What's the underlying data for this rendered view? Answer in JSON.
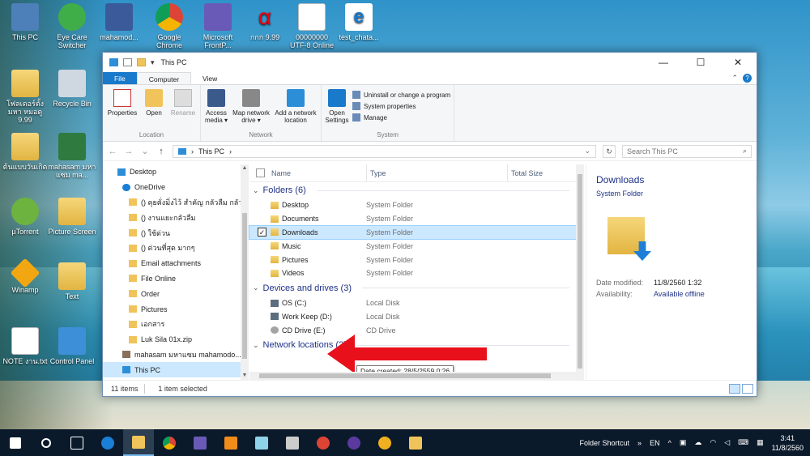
{
  "desktop": {
    "icons": [
      {
        "label": "This PC"
      },
      {
        "label": "Eye Care Switcher"
      },
      {
        "label": "mahamod..."
      },
      {
        "label": "Google Chrome"
      },
      {
        "label": "Microsoft FrontP..."
      },
      {
        "label": "กกก 9.99"
      },
      {
        "label": "00000000 UTF-8 Online"
      },
      {
        "label": "test_chata..."
      },
      {
        "label": "โฟลเดอร์ตั้ง มหา หมอดู 9.99"
      },
      {
        "label": "Recycle Bin"
      },
      {
        "label": "ต้นแบบวันเกิด"
      },
      {
        "label": "mahasam มหาแซม ma..."
      },
      {
        "label": "µTorrent"
      },
      {
        "label": "Picture Screen"
      },
      {
        "label": "Winamp"
      },
      {
        "label": "Text"
      },
      {
        "label": "NOTE งาน.txt"
      },
      {
        "label": "Control Panel"
      }
    ]
  },
  "window": {
    "title": "This PC",
    "controls": {
      "minimize": "—",
      "maximize": "☐",
      "close": "✕"
    },
    "tabs": [
      {
        "label": "File"
      },
      {
        "label": "Computer"
      },
      {
        "label": "View"
      }
    ],
    "ribbon": {
      "location": {
        "name": "Location",
        "buttons": [
          {
            "label": "Properties"
          },
          {
            "label": "Open"
          },
          {
            "label": "Rename"
          }
        ]
      },
      "network": {
        "name": "Network",
        "buttons": [
          {
            "label": "Access media ▾"
          },
          {
            "label": "Map network drive ▾"
          },
          {
            "label": "Add a network location"
          }
        ]
      },
      "system": {
        "name": "System",
        "open_settings": "Open Settings",
        "links": [
          {
            "label": "Uninstall or change a program"
          },
          {
            "label": "System properties"
          },
          {
            "label": "Manage"
          }
        ]
      }
    },
    "address": {
      "path": "This PC",
      "search_placeholder": "Search This PC"
    },
    "nav_pane": [
      {
        "label": "Desktop",
        "icon": "desktop-icon"
      },
      {
        "label": "OneDrive",
        "icon": "onedrive-icon"
      },
      {
        "label": "() คุยคั่งมิ่งไว้ สำคัญ กลัวลืม กลัวข้าม"
      },
      {
        "label": "() งานแยะกลัวลืม"
      },
      {
        "label": "() ใช้ด่วน"
      },
      {
        "label": "() ด่วนที่สุด มากๆ"
      },
      {
        "label": "Email attachments"
      },
      {
        "label": "File Online"
      },
      {
        "label": "Order"
      },
      {
        "label": "Pictures"
      },
      {
        "label": "เอกสาร"
      },
      {
        "label": "Luk Sila 01x.zip"
      },
      {
        "label": "mahasam มหาแซม mahamodo..."
      },
      {
        "label": "This PC"
      }
    ],
    "columns": {
      "name": "Name",
      "type": "Type",
      "total_size": "Total Size"
    },
    "groups": {
      "folders": {
        "title": "Folders (6)",
        "items": [
          {
            "name": "Desktop",
            "type": "System Folder"
          },
          {
            "name": "Documents",
            "type": "System Folder"
          },
          {
            "name": "Downloads",
            "type": "System Folder"
          },
          {
            "name": "Music",
            "type": "System Folder"
          },
          {
            "name": "Pictures",
            "type": "System Folder"
          },
          {
            "name": "Videos",
            "type": "System Folder"
          }
        ]
      },
      "drives": {
        "title": "Devices and drives (3)",
        "items": [
          {
            "name": "OS (C:)",
            "type": "Local Disk"
          },
          {
            "name": "Work Keep (D:)",
            "type": "Local Disk"
          },
          {
            "name": "CD Drive (E:)",
            "type": "CD Drive"
          }
        ]
      },
      "network": {
        "title": "Network locations (2)"
      }
    },
    "tooltip": "Date created: 28/5/2559 0:26",
    "details": {
      "title": "Downloads",
      "subtitle": "System Folder",
      "date_modified_label": "Date modified:",
      "date_modified": "11/8/2560 1:32",
      "availability_label": "Availability:",
      "availability": "Available offline"
    },
    "status": {
      "items": "11 items",
      "selected": "1 item selected"
    }
  },
  "taskbar": {
    "tray_label": "Folder Shortcut",
    "lang": "EN",
    "time": "3:41",
    "date": "11/8/2560"
  },
  "colors": {
    "accent": "#1979ca",
    "selection": "#cce8ff",
    "annotation_arrow": "#e8101b"
  }
}
